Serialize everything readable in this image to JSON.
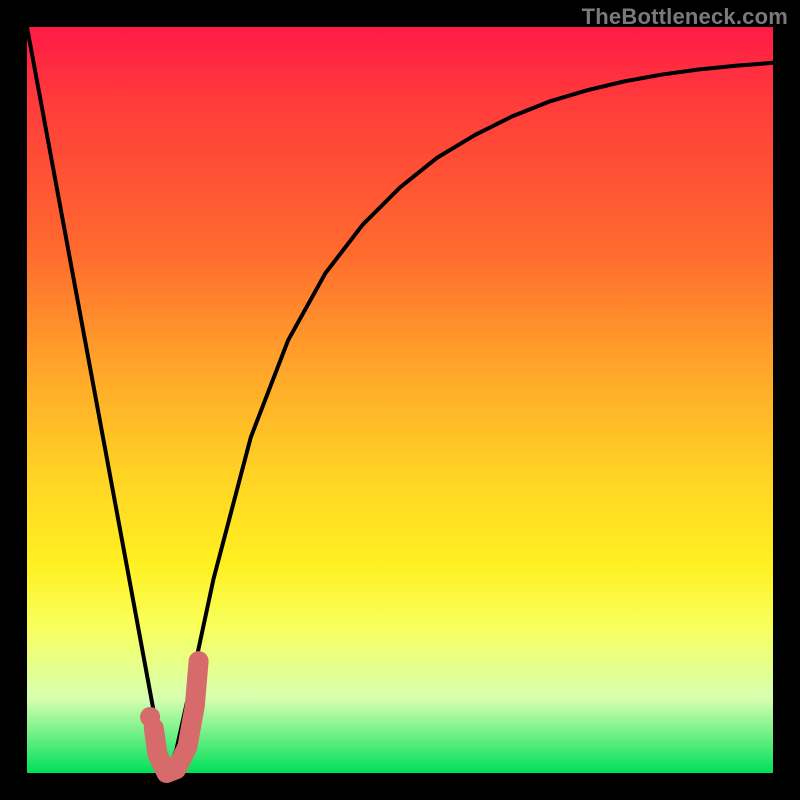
{
  "watermark": "TheBottleneck.com",
  "colors": {
    "frame": "#000000",
    "curve": "#000000",
    "marker": "#d76b6b",
    "gradient_stops": [
      "#ff1a46",
      "#ff3b3b",
      "#ff6a2e",
      "#ffa32a",
      "#ffd324",
      "#fff021",
      "#f9ff5a",
      "#d7ffb0",
      "#00e05a"
    ]
  },
  "chart_data": {
    "type": "line",
    "title": "",
    "xlabel": "",
    "ylabel": "",
    "xlim": [
      0,
      100
    ],
    "ylim": [
      0,
      100
    ],
    "series": [
      {
        "name": "bottleneck-curve",
        "x": [
          0,
          5,
          10,
          15,
          17.5,
          18.7,
          20,
          22,
          25,
          30,
          35,
          40,
          45,
          50,
          55,
          60,
          65,
          70,
          75,
          80,
          85,
          90,
          95,
          100
        ],
        "values": [
          100,
          73,
          46,
          19,
          5.5,
          0,
          3,
          12,
          26,
          45,
          58,
          67,
          73.5,
          78.5,
          82.5,
          85.5,
          88,
          90,
          91.5,
          92.7,
          93.6,
          94.3,
          94.8,
          95.2
        ]
      }
    ],
    "marker": {
      "name": "hook-marker",
      "points_x": [
        17.0,
        17.5,
        18.7,
        20.0,
        21.5,
        22.5,
        23.0
      ],
      "points_y": [
        6.0,
        2.5,
        0.0,
        0.5,
        3.5,
        9.0,
        15.0
      ]
    },
    "marker_dot": {
      "x": 16.5,
      "y": 7.5
    }
  }
}
